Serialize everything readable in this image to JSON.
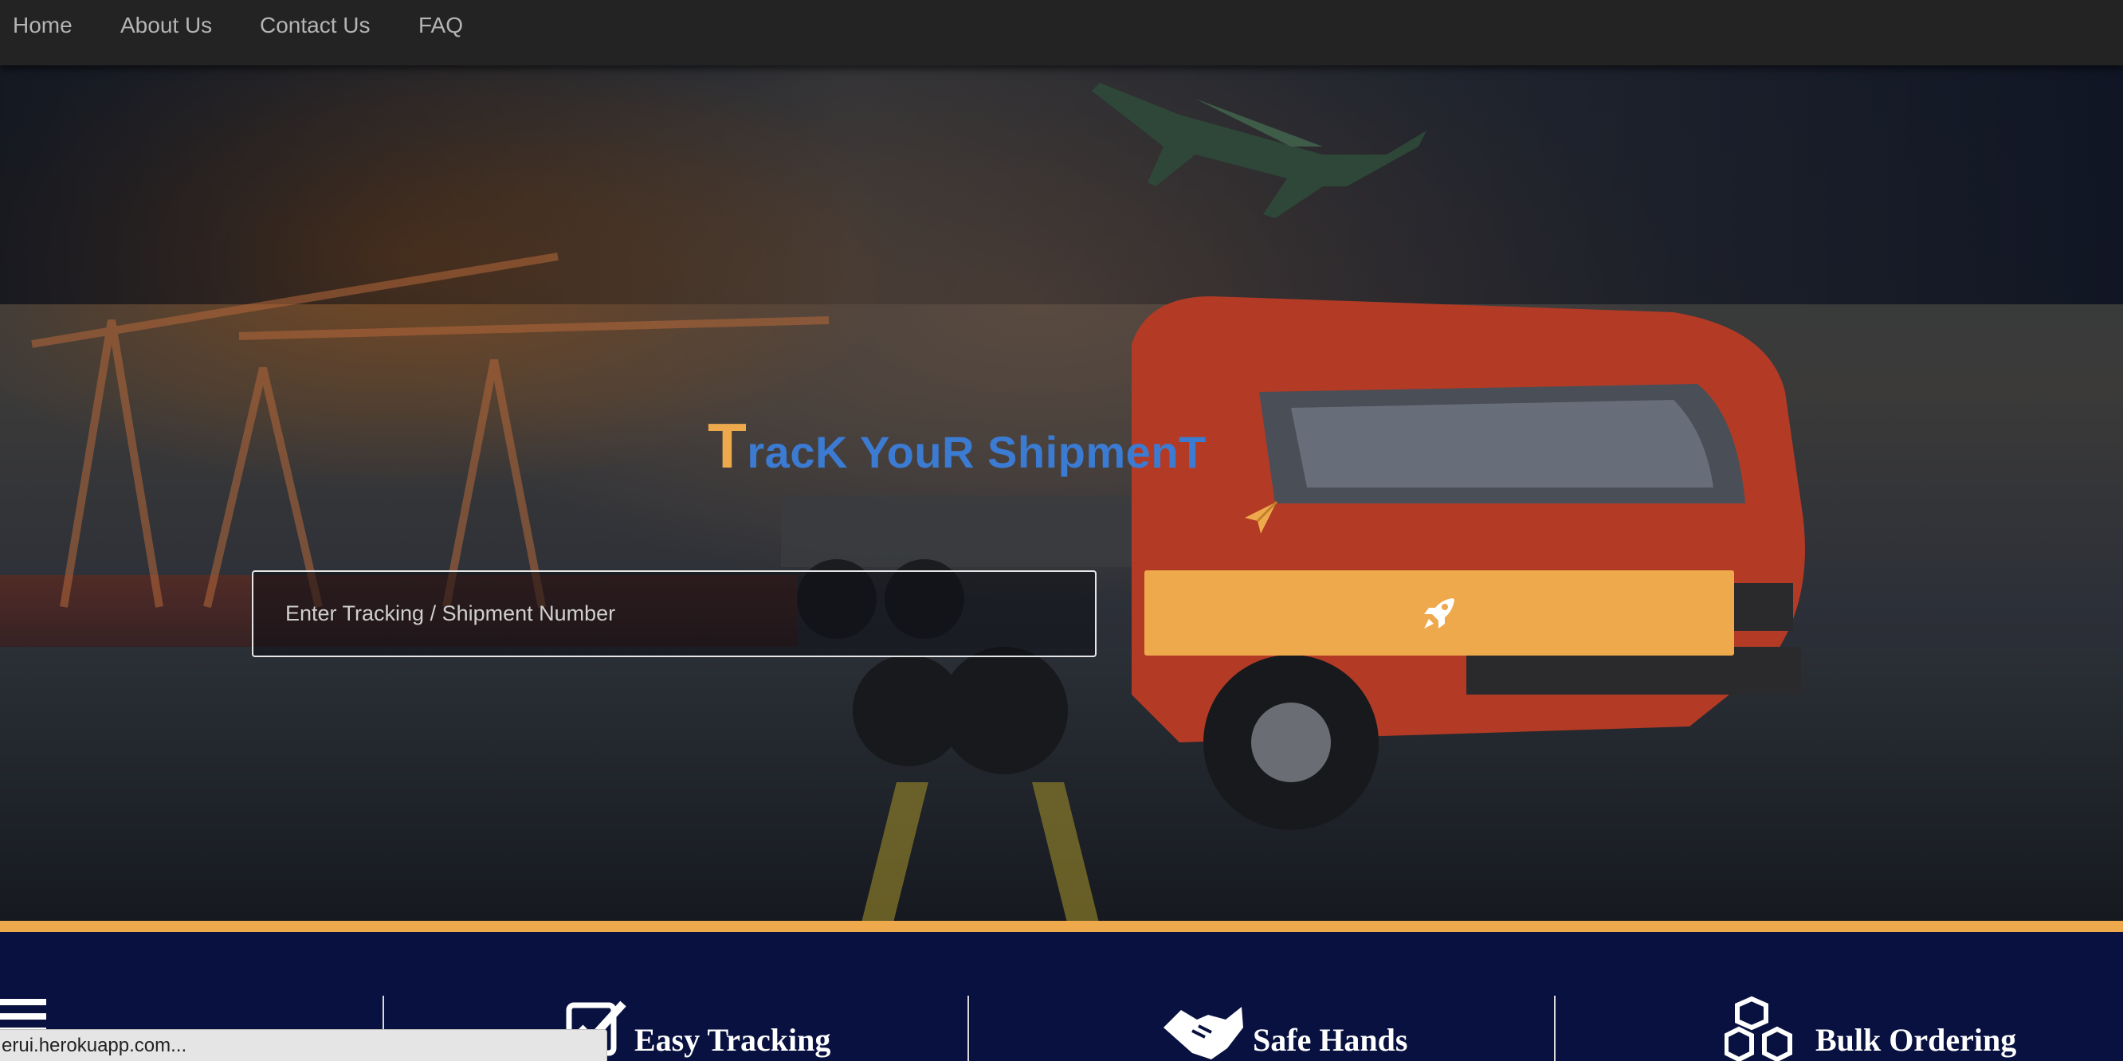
{
  "nav": {
    "items": [
      {
        "label": "Home"
      },
      {
        "label": "About Us"
      },
      {
        "label": "Contact Us"
      },
      {
        "label": "FAQ"
      }
    ]
  },
  "hero": {
    "title_first_letter": "T",
    "title_rest": "racK YouR ShipmenT",
    "title_icon": "paper-plane-icon",
    "input_placeholder": "Enter Tracking / Shipment Number",
    "input_value": "",
    "button_icon": "rocket-icon"
  },
  "features": {
    "items": [
      {
        "label": "",
        "icon": "list-icon"
      },
      {
        "label": "Easy Tracking",
        "icon": "checkbox-icon"
      },
      {
        "label": "Safe Hands",
        "icon": "handshake-icon"
      },
      {
        "label": "Bulk Ordering",
        "icon": "cubes-icon"
      }
    ]
  },
  "status_bar": {
    "url": "erui.herokuapp.com..."
  },
  "colors": {
    "accent": "#eea94c",
    "title_blue": "#3b7bd1",
    "navbar_bg": "#232323",
    "features_bg": "#08113f"
  }
}
